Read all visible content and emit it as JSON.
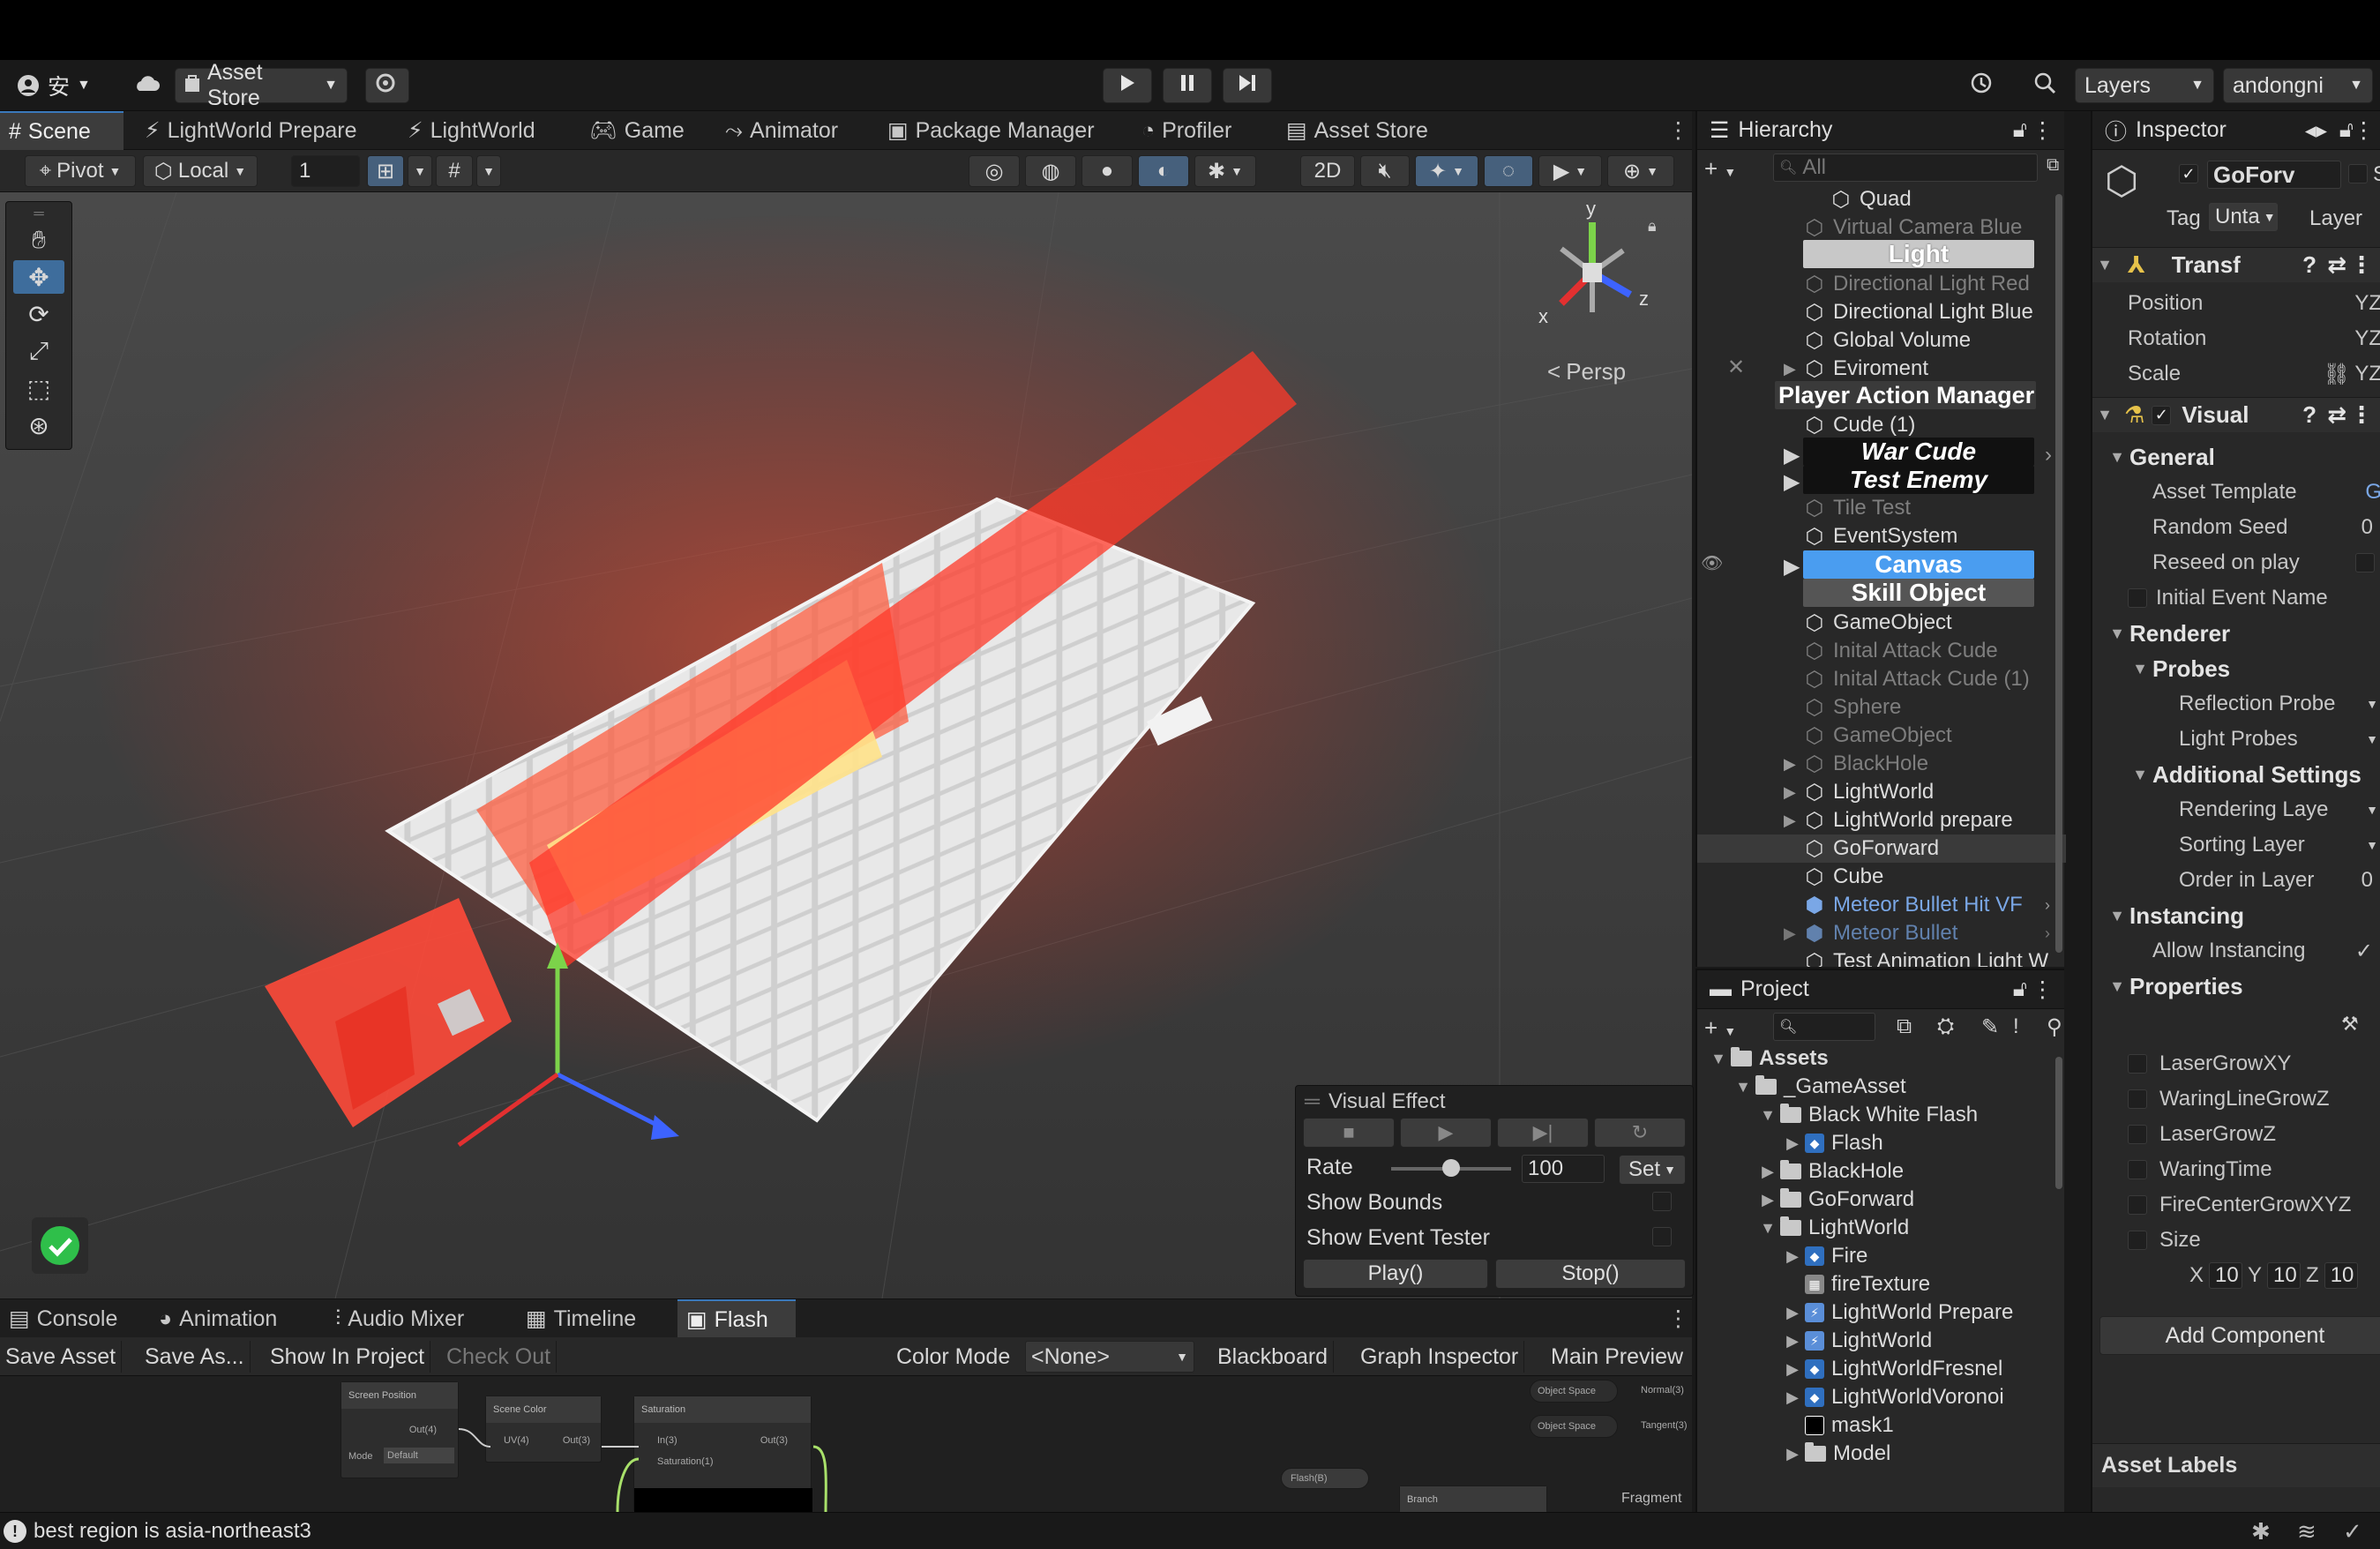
{
  "toolbar": {
    "account_icon": "account-icon",
    "lang_label": "安",
    "asset_store_label": "Asset Store",
    "layers_label": "Layers",
    "account_name": "andongni"
  },
  "scene_tabs": [
    {
      "label": "Scene"
    },
    {
      "label": "LightWorld Prepare"
    },
    {
      "label": "LightWorld"
    },
    {
      "label": "Game"
    },
    {
      "label": "Animator"
    },
    {
      "label": "Package Manager"
    },
    {
      "label": "Profiler"
    },
    {
      "label": "Asset Store"
    }
  ],
  "scene_toolbar": {
    "pivot": "Pivot",
    "local": "Local",
    "grid_snap_value": "1",
    "mode_2d": "2D"
  },
  "viewport": {
    "persp_label": "Persp",
    "gizmo_y": "y",
    "gizmo_x": "x",
    "gizmo_z": "z"
  },
  "visual_effect_panel": {
    "title": "Visual Effect",
    "rate_label": "Rate",
    "rate_value": "100",
    "set_label": "Set",
    "show_bounds": "Show Bounds",
    "show_event_tester": "Show Event Tester",
    "play": "Play()",
    "stop": "Stop()",
    "rate_fraction": 0.5
  },
  "bottom_tabs": [
    {
      "label": "Console"
    },
    {
      "label": "Animation"
    },
    {
      "label": "Audio Mixer"
    },
    {
      "label": "Timeline"
    },
    {
      "label": "Flash"
    }
  ],
  "graph_toolbar": {
    "save_asset": "Save Asset",
    "save_as": "Save As...",
    "show_in_project": "Show In Project",
    "check_out": "Check Out",
    "color_mode_label": "Color Mode",
    "color_mode_value": "<None>",
    "blackboard": "Blackboard",
    "graph_inspector": "Graph Inspector",
    "main_preview": "Main Preview"
  },
  "graph_nodes": {
    "screen_position": "Screen Position",
    "screen_position_out": "Out(4)",
    "mode_label": "Mode",
    "mode_value": "Default",
    "scene_color": "Scene Color",
    "scene_color_in": "UV(4)",
    "scene_color_out": "Out(3)",
    "saturation": "Saturation",
    "saturation_in": "In(3)",
    "saturation_param": "Saturation(1)",
    "saturation_out": "Out(3)",
    "object_space_1": "Object Space",
    "normal": "Normal(3)",
    "object_space_2": "Object Space",
    "tangent": "Tangent(3)",
    "flash_prop": "Flash(B)",
    "branch": "Branch",
    "fragment": "Fragment"
  },
  "status": {
    "message": "best region is asia-northeast3"
  },
  "hierarchy": {
    "title": "Hierarchy",
    "search_placeholder": "All",
    "items": [
      {
        "label": "Quad"
      },
      {
        "label": "Virtual Camera Blue"
      },
      {
        "label": "Light"
      },
      {
        "label": "Directional Light Red"
      },
      {
        "label": "Directional Light Blue"
      },
      {
        "label": "Global Volume"
      },
      {
        "label": "Eviroment"
      },
      {
        "label": "Player Action Manager"
      },
      {
        "label": "Cude (1)"
      },
      {
        "label": "War Cude"
      },
      {
        "label": "Test Enemy"
      },
      {
        "label": "Tile Test"
      },
      {
        "label": "EventSystem"
      },
      {
        "label": "Canvas"
      },
      {
        "label": "Skill Object"
      },
      {
        "label": "GameObject"
      },
      {
        "label": "Inital Attack Cude"
      },
      {
        "label": "Inital Attack Cude (1)"
      },
      {
        "label": "Sphere"
      },
      {
        "label": "GameObject"
      },
      {
        "label": "BlackHole"
      },
      {
        "label": "LightWorld"
      },
      {
        "label": "LightWorld prepare"
      },
      {
        "label": "GoForward"
      },
      {
        "label": "Cube"
      },
      {
        "label": "Meteor Bullet Hit VF"
      },
      {
        "label": "Meteor Bullet"
      },
      {
        "label": "Test Animation Light W"
      }
    ]
  },
  "project": {
    "title": "Project",
    "items": [
      {
        "label": "Assets"
      },
      {
        "label": "_GameAsset"
      },
      {
        "label": "Black White Flash"
      },
      {
        "label": "Flash"
      },
      {
        "label": "BlackHole"
      },
      {
        "label": "GoForward"
      },
      {
        "label": "LightWorld"
      },
      {
        "label": "Fire"
      },
      {
        "label": "fireTexture"
      },
      {
        "label": "LightWorld Prepare"
      },
      {
        "label": "LightWorld"
      },
      {
        "label": "LightWorldFresnel"
      },
      {
        "label": "LightWorldVoronoi"
      },
      {
        "label": "mask1"
      },
      {
        "label": "Model"
      }
    ]
  },
  "inspector": {
    "title": "Inspector",
    "object_name": "GoForv",
    "static_label": "Stati",
    "tag_label": "Tag",
    "tag_value": "Unta",
    "layer_label": "Layer",
    "transform_title": "Transf",
    "position": "Position",
    "rotation": "Rotation",
    "scale": "Scale",
    "xyz": "YZ",
    "visual_title": "Visual",
    "general": "General",
    "asset_template": "Asset Template",
    "asset_template_value": "G",
    "random_seed": "Random Seed",
    "random_seed_value": "0",
    "reseed_on_play": "Reseed on play",
    "initial_event_name": "Initial Event Name",
    "renderer": "Renderer",
    "probes": "Probes",
    "reflection_probes": "Reflection Probe",
    "light_probes": "Light Probes",
    "additional_settings": "Additional Settings",
    "rendering_layer": "Rendering Laye",
    "sorting_layer": "Sorting Layer",
    "order_in_layer": "Order in Layer",
    "order_in_layer_value": "0",
    "instancing": "Instancing",
    "allow_instancing": "Allow Instancing",
    "properties": "Properties",
    "props": [
      {
        "label": "LaserGrowXY"
      },
      {
        "label": "WaringLineGrowZ"
      },
      {
        "label": "LaserGrowZ"
      },
      {
        "label": "WaringTime"
      },
      {
        "label": "FireCenterGrowXYZ"
      },
      {
        "label": "Size"
      }
    ],
    "size_x_label": "X",
    "size_x": "10",
    "size_y_label": "Y",
    "size_y": "10",
    "size_z_label": "Z",
    "size_z": "10",
    "add_component": "Add Component",
    "asset_labels": "Asset Labels"
  },
  "colors": {
    "accent": "#3a79bb",
    "selection": "#2c6fcf",
    "success": "#2fbf4a"
  }
}
